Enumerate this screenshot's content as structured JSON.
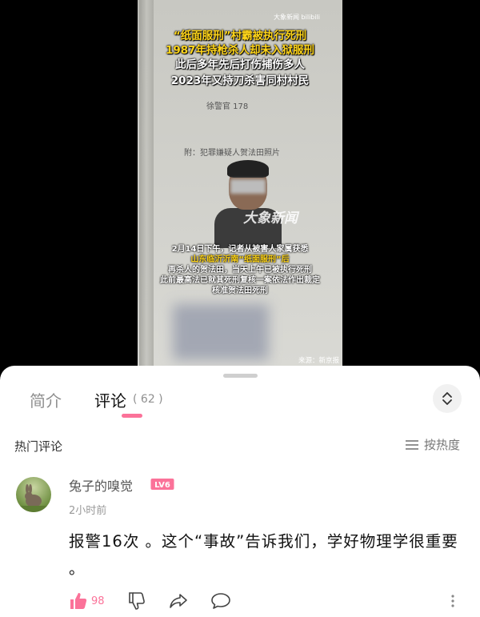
{
  "video": {
    "headline": [
      "“纸面服刑”村霸被执行死刑",
      "1987年持枪杀人却未入狱服刑",
      "此后多年先后打伤捕伤多人",
      "2023年又持刀杀害同村村民"
    ],
    "doc_text": [
      "附：犯罪嫌疑人贺法田照片",
      "徐警官 178"
    ],
    "watermark": "大象新闻",
    "top_watermark": "大象新闻 bilibili",
    "caption": [
      {
        "text": "2月14日下午，记者从被害人家属获悉",
        "color": "#ffffff"
      },
      {
        "text": "山东临沂沂南“纸面服刑”后",
        "color": "#ffd51a"
      },
      {
        "text": "再杀人的贺法田，当天上午已被执行死刑",
        "color": "#ffffff"
      },
      {
        "text": "此前最高法已就其死刑复核一案依法作出裁定",
        "color": "#ffffff"
      },
      {
        "text": "核准贺法田死刑",
        "color": "#ffffff"
      }
    ],
    "source": "来源：新京报"
  },
  "tabs": {
    "intro": "简介",
    "comments": "评论",
    "comment_count": "( 62 )"
  },
  "hot_label": "热门评论",
  "sort_label": "按热度",
  "comment": {
    "username": "兔子的嗅觉",
    "level": "LV6",
    "time": "2小时前",
    "content": "报警16次 。这个“事故”告诉我们，学好物理学很重要 。",
    "likes": "98"
  },
  "colors": {
    "accent": "#fb7299",
    "level_badge": "#fb7299"
  },
  "icons": [
    "chevron-up-down-icon",
    "sort-lines-icon",
    "like-icon",
    "dislike-icon",
    "share-icon",
    "reply-icon",
    "more-vertical-icon"
  ]
}
